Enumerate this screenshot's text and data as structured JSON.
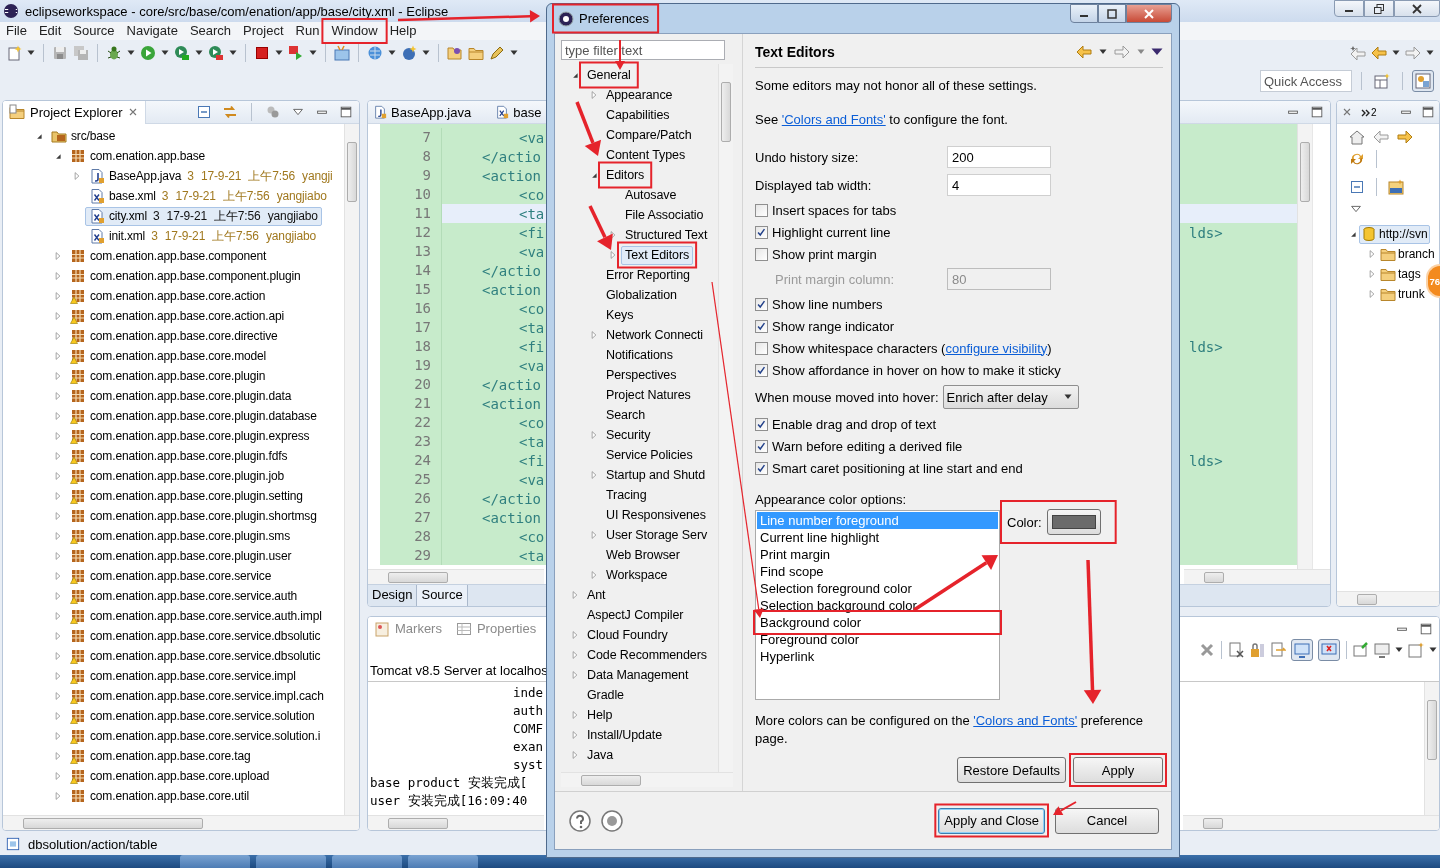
{
  "window": {
    "title": "eclipseworkspace - core/src/base/com/enation/app/base/city.xml - Eclipse"
  },
  "menu": [
    {
      "label": "File"
    },
    {
      "label": "Edit"
    },
    {
      "label": "Source"
    },
    {
      "label": "Navigate"
    },
    {
      "label": "Search"
    },
    {
      "label": "Project"
    },
    {
      "label": "Run"
    },
    {
      "label": "Window",
      "highlighted": true
    },
    {
      "label": "Help"
    }
  ],
  "quick_access": {
    "placeholder": "Quick Access"
  },
  "project_explorer": {
    "title": "Project Explorer",
    "tree": [
      {
        "label": "src/base",
        "kind": "source_folder",
        "expanded": true,
        "selected": false,
        "children": [
          {
            "label": "com.enation.app.base",
            "kind": "package",
            "expanded": true,
            "selected": false,
            "children": [
              {
                "label": "BaseApp.java",
                "kind": "java",
                "meta": "3 17-9-21 上午7:56 yangji",
                "expanded": false,
                "selected": false
              },
              {
                "label": "base.xml",
                "kind": "xml",
                "meta": "3 17-9-21 上午7:56 yangjiabo",
                "selected": false
              },
              {
                "label": "city.xml",
                "kind": "xml",
                "meta": "3 17-9-21 上午7:56 yangjiabo",
                "selected": true
              },
              {
                "label": "init.xml",
                "kind": "xml",
                "meta": "3 17-9-21 上午7:56 yangjiabo",
                "selected": false
              }
            ]
          },
          {
            "label": "com.enation.app.base.component",
            "kind": "package",
            "expanded": false,
            "selected": false
          },
          {
            "label": "com.enation.app.base.component.plugin",
            "kind": "package",
            "expanded": false,
            "selected": false
          },
          {
            "label": "com.enation.app.base.core.action",
            "kind": "package",
            "warning": true,
            "expanded": false,
            "selected": false
          },
          {
            "label": "com.enation.app.base.core.action.api",
            "kind": "package",
            "warning": true,
            "expanded": false,
            "selected": false
          },
          {
            "label": "com.enation.app.base.core.directive",
            "kind": "package",
            "warning": true,
            "expanded": false,
            "selected": false
          },
          {
            "label": "com.enation.app.base.core.model",
            "kind": "package",
            "warning": true,
            "expanded": false,
            "selected": false
          },
          {
            "label": "com.enation.app.base.core.plugin",
            "kind": "package",
            "warning": true,
            "expanded": false,
            "selected": false
          },
          {
            "label": "com.enation.app.base.core.plugin.data",
            "kind": "package",
            "expanded": false,
            "selected": false
          },
          {
            "label": "com.enation.app.base.core.plugin.database",
            "kind": "package",
            "warning": true,
            "expanded": false,
            "selected": false
          },
          {
            "label": "com.enation.app.base.core.plugin.express",
            "kind": "package",
            "warning": true,
            "expanded": false,
            "selected": false
          },
          {
            "label": "com.enation.app.base.core.plugin.fdfs",
            "kind": "package",
            "warning": true,
            "expanded": false,
            "selected": false
          },
          {
            "label": "com.enation.app.base.core.plugin.job",
            "kind": "package",
            "warning": true,
            "expanded": false,
            "selected": false
          },
          {
            "label": "com.enation.app.base.core.plugin.setting",
            "kind": "package",
            "warning": true,
            "expanded": false,
            "selected": false
          },
          {
            "label": "com.enation.app.base.core.plugin.shortmsg",
            "kind": "package",
            "expanded": false,
            "selected": false
          },
          {
            "label": "com.enation.app.base.core.plugin.sms",
            "kind": "package",
            "warning": true,
            "expanded": false,
            "selected": false
          },
          {
            "label": "com.enation.app.base.core.plugin.user",
            "kind": "package",
            "expanded": false,
            "selected": false
          },
          {
            "label": "com.enation.app.base.core.service",
            "kind": "package",
            "warning": true,
            "expanded": false,
            "selected": false
          },
          {
            "label": "com.enation.app.base.core.service.auth",
            "kind": "package",
            "warning": true,
            "expanded": false,
            "selected": false
          },
          {
            "label": "com.enation.app.base.core.service.auth.impl",
            "kind": "package",
            "warning": true,
            "expanded": false,
            "selected": false
          },
          {
            "label": "com.enation.app.base.core.service.dbsolutic",
            "kind": "package",
            "expanded": false,
            "selected": false
          },
          {
            "label": "com.enation.app.base.core.service.dbsolutic",
            "kind": "package",
            "warning": true,
            "expanded": false,
            "selected": false
          },
          {
            "label": "com.enation.app.base.core.service.impl",
            "kind": "package",
            "warning": true,
            "expanded": false,
            "selected": false
          },
          {
            "label": "com.enation.app.base.core.service.impl.cach",
            "kind": "package",
            "warning": true,
            "expanded": false,
            "selected": false
          },
          {
            "label": "com.enation.app.base.core.service.solution",
            "kind": "package",
            "warning": true,
            "expanded": false,
            "selected": false
          },
          {
            "label": "com.enation.app.base.core.service.solution.i",
            "kind": "package",
            "warning": true,
            "expanded": false,
            "selected": false
          },
          {
            "label": "com.enation.app.base.core.tag",
            "kind": "package",
            "warning": true,
            "expanded": false,
            "selected": false
          },
          {
            "label": "com.enation.app.base.core.upload",
            "kind": "package",
            "warning": true,
            "expanded": false,
            "selected": false
          },
          {
            "label": "com.enation.app.base.core.util",
            "kind": "package",
            "expanded": false,
            "selected": false
          }
        ]
      }
    ]
  },
  "editor": {
    "tabs": [
      {
        "label": "BaseApp.java",
        "kind": "java",
        "selected": false
      },
      {
        "label": "base",
        "kind": "xml",
        "selected": false
      }
    ],
    "lines": [
      {
        "number": "7",
        "text": "<va",
        "kind": "child",
        "current": false
      },
      {
        "number": "8",
        "text": "</actio",
        "kind": "action",
        "current": false
      },
      {
        "number": "9",
        "text": "<action",
        "kind": "action",
        "current": false
      },
      {
        "number": "10",
        "text": "<co",
        "kind": "child",
        "current": false
      },
      {
        "number": "11",
        "text": "<ta",
        "kind": "child",
        "current": true
      },
      {
        "number": "12",
        "text": "<fi",
        "kind": "child",
        "current": false,
        "tail": "lds>"
      },
      {
        "number": "13",
        "text": "<va",
        "kind": "child",
        "current": false
      },
      {
        "number": "14",
        "text": "</actio",
        "kind": "action",
        "current": false
      },
      {
        "number": "15",
        "text": "<action",
        "kind": "action",
        "current": false
      },
      {
        "number": "16",
        "text": "<co",
        "kind": "child",
        "current": false
      },
      {
        "number": "17",
        "text": "<ta",
        "kind": "child",
        "current": false
      },
      {
        "number": "18",
        "text": "<fi",
        "kind": "child",
        "current": false,
        "tail": "lds>"
      },
      {
        "number": "19",
        "text": "<va",
        "kind": "child",
        "current": false
      },
      {
        "number": "20",
        "text": "</actio",
        "kind": "action",
        "current": false
      },
      {
        "number": "21",
        "text": "<action",
        "kind": "action",
        "current": false
      },
      {
        "number": "22",
        "text": "<co",
        "kind": "child",
        "current": false
      },
      {
        "number": "23",
        "text": "<ta",
        "kind": "child",
        "current": false
      },
      {
        "number": "24",
        "text": "<fi",
        "kind": "child",
        "current": false,
        "tail": "lds>"
      },
      {
        "number": "25",
        "text": "<va",
        "kind": "child",
        "current": false
      },
      {
        "number": "26",
        "text": "</actio",
        "kind": "action",
        "current": false
      },
      {
        "number": "27",
        "text": "<action",
        "kind": "action",
        "current": false
      },
      {
        "number": "28",
        "text": "<co",
        "kind": "child",
        "current": false
      },
      {
        "number": "29",
        "text": "<ta",
        "kind": "child",
        "current": false
      }
    ],
    "bottom_tabs": [
      {
        "label": "Design",
        "selected": false
      },
      {
        "label": "Source",
        "selected": true
      }
    ]
  },
  "svn_panel": {
    "more_count": "2",
    "badge": "76",
    "tree": [
      {
        "label": "http://svn",
        "kind": "repository",
        "expanded": true,
        "selected": true,
        "children": [
          {
            "label": "branch",
            "kind": "folder",
            "expanded": false,
            "selected": false
          },
          {
            "label": "tags",
            "kind": "folder",
            "expanded": false,
            "selected": false
          },
          {
            "label": "trunk",
            "kind": "folder",
            "expanded": false,
            "selected": false
          }
        ]
      }
    ]
  },
  "bottom_panel": {
    "tabs": [
      {
        "label": "Markers",
        "kind": "markers"
      },
      {
        "label": "Properties",
        "kind": "properties"
      }
    ],
    "console_title": "Tomcat v8.5 Server at localhos",
    "lines": [
      {
        "text": "inde",
        "kind": "wrapped"
      },
      {
        "text": "auth",
        "kind": "wrapped"
      },
      {
        "text": "COMF",
        "kind": "wrapped"
      },
      {
        "text": "exan",
        "kind": "wrapped"
      },
      {
        "text": "syst",
        "kind": "wrapped"
      },
      {
        "text": "base product 安装完成[",
        "kind": "plain"
      },
      {
        "text": "user 安装完成[16:09:40",
        "kind": "plain"
      }
    ]
  },
  "status_bar": {
    "text": "dbsolution/action/table"
  },
  "preferences": {
    "title": {
      "text": "Preferences",
      "highlighted": true
    },
    "filter": {
      "placeholder": "type filter text"
    },
    "tree": [
      {
        "label": "General",
        "expanded": true,
        "selected": false,
        "highlighted": true,
        "children": [
          {
            "label": "Appearance",
            "expanded": false,
            "selected": false
          },
          {
            "label": "Capabilities",
            "selected": false
          },
          {
            "label": "Compare/Patch",
            "selected": false
          },
          {
            "label": "Content Types",
            "selected": false
          },
          {
            "label": "Editors",
            "expanded": true,
            "selected": false,
            "highlighted": true,
            "children": [
              {
                "label": "Autosave",
                "selected": false
              },
              {
                "label": "File Associatio",
                "selected": false
              },
              {
                "label": "Structured Text",
                "expanded": false,
                "selected": false
              },
              {
                "label": "Text Editors",
                "expanded": false,
                "selected": true,
                "highlighted": true
              }
            ]
          },
          {
            "label": "Error Reporting",
            "selected": false
          },
          {
            "label": "Globalization",
            "selected": false
          },
          {
            "label": "Keys",
            "selected": false
          },
          {
            "label": "Network Connecti",
            "expanded": false,
            "selected": false
          },
          {
            "label": "Notifications",
            "selected": false
          },
          {
            "label": "Perspectives",
            "selected": false
          },
          {
            "label": "Project Natures",
            "selected": false
          },
          {
            "label": "Search",
            "selected": false
          },
          {
            "label": "Security",
            "expanded": false,
            "selected": false
          },
          {
            "label": "Service Policies",
            "selected": false
          },
          {
            "label": "Startup and Shutd",
            "expanded": false,
            "selected": false
          },
          {
            "label": "Tracing",
            "selected": false
          },
          {
            "label": "UI Responsivenes",
            "selected": false
          },
          {
            "label": "User Storage Serv",
            "expanded": false,
            "selected": false
          },
          {
            "label": "Web Browser",
            "selected": false
          },
          {
            "label": "Workspace",
            "expanded": false,
            "selected": false
          }
        ]
      },
      {
        "label": "Ant",
        "expanded": false,
        "selected": false
      },
      {
        "label": "AspectJ Compiler",
        "selected": false
      },
      {
        "label": "Cloud Foundry",
        "expanded": false,
        "selected": false
      },
      {
        "label": "Code Recommenders",
        "expanded": false,
        "selected": false
      },
      {
        "label": "Data Management",
        "expanded": false,
        "selected": false
      },
      {
        "label": "Gradle",
        "selected": false
      },
      {
        "label": "Help",
        "expanded": false,
        "selected": false
      },
      {
        "label": "Install/Update",
        "expanded": false,
        "selected": false
      },
      {
        "label": "Java",
        "expanded": false,
        "selected": false
      }
    ],
    "page_title": "Text Editors",
    "options": [
      {
        "kind": "note",
        "text": "Some editors may not honor all of these settings."
      },
      {
        "kind": "link_note",
        "before": "See ",
        "link": "'Colors and Fonts'",
        "after": " to configure the font."
      },
      {
        "kind": "number",
        "label": "Undo history size:",
        "value": "200",
        "disabled": false
      },
      {
        "kind": "number",
        "label": "Displayed tab width:",
        "value": "4",
        "disabled": false
      },
      {
        "kind": "checkbox",
        "label": "Insert spaces for tabs",
        "checked": false
      },
      {
        "kind": "checkbox",
        "label": "Highlight current line",
        "checked": true
      },
      {
        "kind": "checkbox",
        "label": "Show print margin",
        "checked": false
      },
      {
        "kind": "subnumber",
        "label": "Print margin column:",
        "value": "80",
        "disabled": true
      },
      {
        "kind": "checkbox",
        "label": "Show line numbers",
        "checked": true
      },
      {
        "kind": "checkbox",
        "label": "Show range indicator",
        "checked": true
      },
      {
        "kind": "checkbox",
        "label": "Show whitespace characters (",
        "link": "configure visibility",
        "after": ")",
        "checked": false
      },
      {
        "kind": "checkbox",
        "label": "Show affordance in hover on how to make it sticky",
        "checked": true
      },
      {
        "kind": "dropdown",
        "label": "When mouse moved into hover:",
        "value": "Enrich after delay"
      },
      {
        "kind": "checkbox",
        "label": "Enable drag and drop of text",
        "checked": true
      },
      {
        "kind": "checkbox",
        "label": "Warn before editing a derived file",
        "checked": true
      },
      {
        "kind": "checkbox",
        "label": "Smart caret positioning at line start and end",
        "checked": true
      }
    ],
    "appearance": {
      "label": "Appearance color options:",
      "items": [
        {
          "label": "Line number foreground",
          "selected": true
        },
        {
          "label": "Current line highlight",
          "selected": false
        },
        {
          "label": "Print margin",
          "selected": false
        },
        {
          "label": "Find scope",
          "selected": false
        },
        {
          "label": "Selection foreground color",
          "selected": false
        },
        {
          "label": "Selection background color",
          "selected": false
        },
        {
          "label": "Background color",
          "selected": false,
          "highlighted": true
        },
        {
          "label": "Foreground color",
          "selected": false
        },
        {
          "label": "Hyperlink",
          "selected": false
        }
      ],
      "color_label": "Color:",
      "color": "#6b6b6b",
      "highlighted": true
    },
    "more_colors": {
      "before": "More colors can be configured on the ",
      "link": "'Colors and Fonts'",
      "after": " preference page."
    },
    "page_buttons": [
      {
        "label": "Restore Defaults"
      },
      {
        "label": "Apply",
        "highlighted": true
      }
    ],
    "dialog_buttons": [
      {
        "label": "Apply and Close",
        "default": true,
        "highlighted": true
      },
      {
        "label": "Cancel",
        "default": false
      }
    ]
  }
}
